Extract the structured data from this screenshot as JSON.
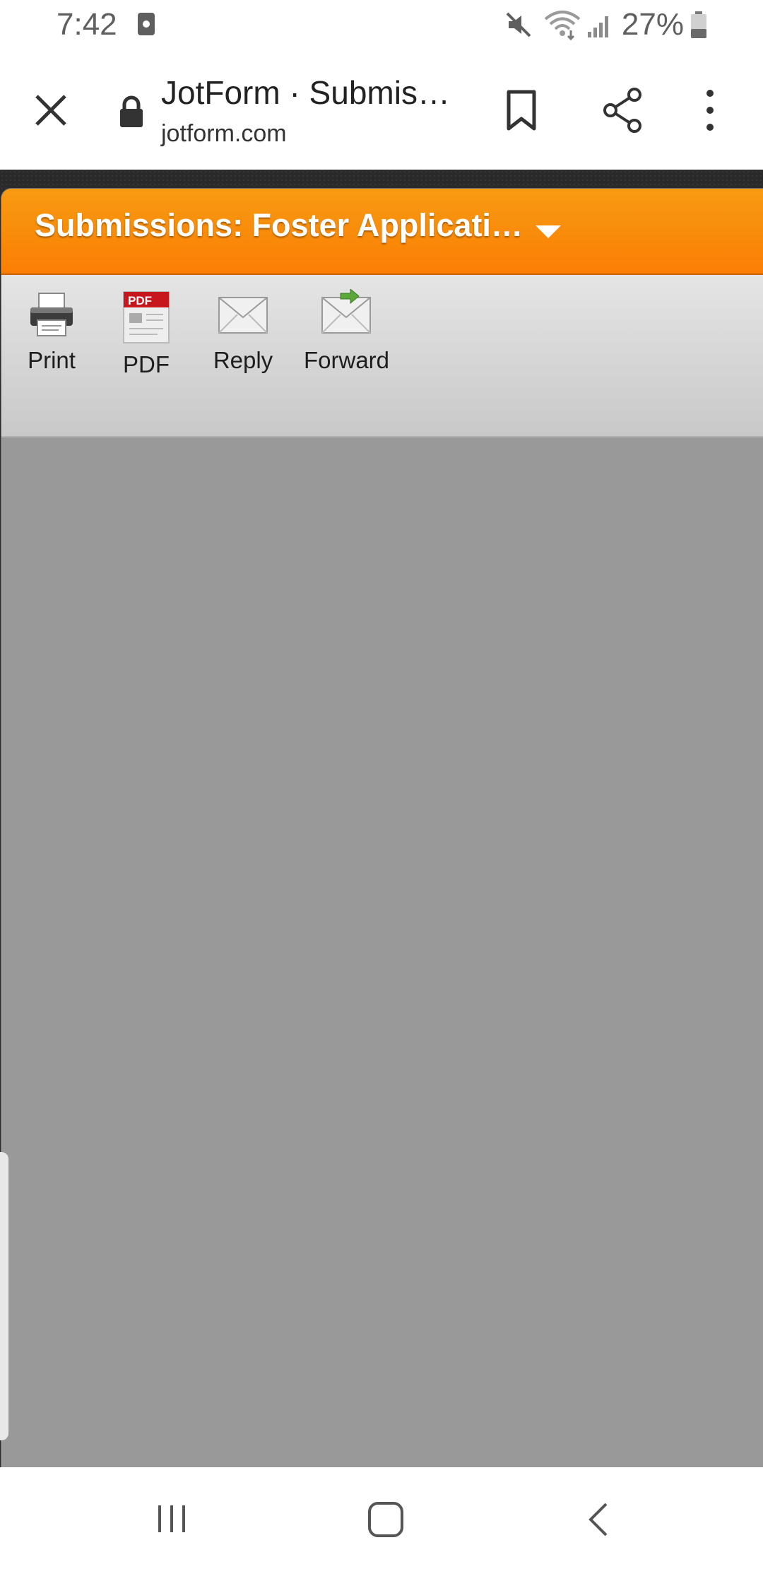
{
  "status_bar": {
    "time": "7:42",
    "battery": "27%",
    "icons": [
      "notification-icon",
      "mute-icon",
      "wifi-icon",
      "signal-icon",
      "battery-icon"
    ]
  },
  "browser": {
    "title": "JotForm · Submis…",
    "domain": "jotform.com",
    "icons": [
      "close-icon",
      "lock-icon",
      "bookmark-icon",
      "share-icon",
      "more-icon"
    ]
  },
  "app": {
    "header_title": "Submissions: Foster Applicati…",
    "header_color": "#f98a09",
    "toolbar": {
      "buttons": [
        {
          "label": "Print",
          "icon": "printer-icon"
        },
        {
          "label": "PDF",
          "icon": "pdf-icon"
        },
        {
          "label": "Reply",
          "icon": "envelope-icon"
        },
        {
          "label": "Forward",
          "icon": "forward-envelope-icon"
        }
      ],
      "pdf_icon_text": "PDF"
    }
  },
  "nav_bar": {
    "icons": [
      "recents-icon",
      "home-icon",
      "back-icon"
    ]
  }
}
